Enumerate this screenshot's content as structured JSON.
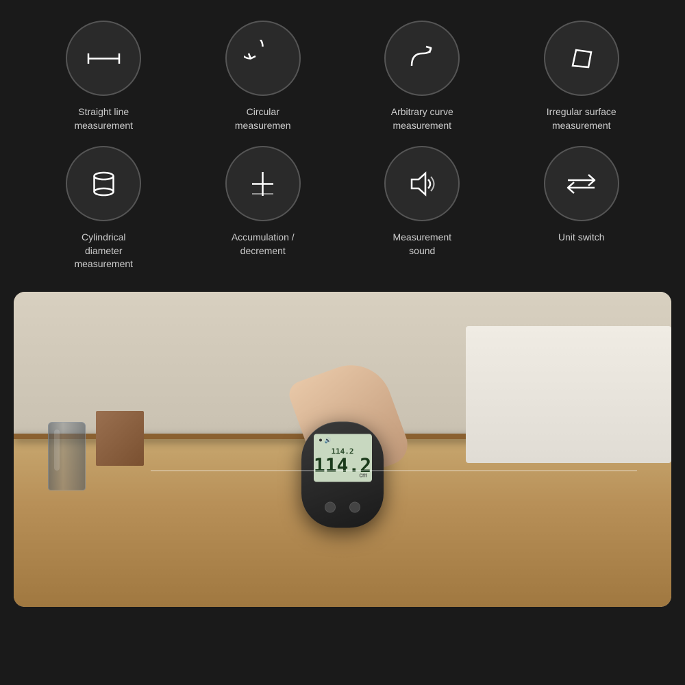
{
  "background": "#1a1a1a",
  "features": [
    {
      "id": "straight-line",
      "label": "Straight line\nmeasurement",
      "icon_type": "straight-line"
    },
    {
      "id": "circular",
      "label": "Circular\nmeasuremen",
      "icon_type": "circular"
    },
    {
      "id": "arbitrary-curve",
      "label": "Arbitrary curve\nmeasurement",
      "icon_type": "arbitrary-curve"
    },
    {
      "id": "irregular-surface",
      "label": "Irregular surface\nmeasurement",
      "icon_type": "irregular-surface"
    },
    {
      "id": "cylindrical",
      "label": "Cylindrical\ndiameter\nmeasurement",
      "icon_type": "cylindrical"
    },
    {
      "id": "accumulation",
      "label": "Accumulation /\ndecrement",
      "icon_type": "accumulation"
    },
    {
      "id": "measurement-sound",
      "label": "Measurement\nsound",
      "icon_type": "sound"
    },
    {
      "id": "unit-switch",
      "label": "Unit switch",
      "icon_type": "unit-switch"
    }
  ],
  "device": {
    "display_value_small": "114.2",
    "display_value_large": "114.2"
  }
}
